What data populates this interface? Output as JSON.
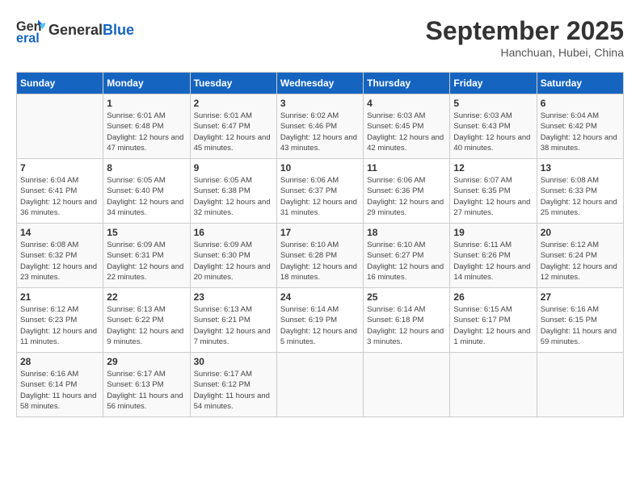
{
  "header": {
    "logo_line1": "General",
    "logo_line2": "Blue",
    "month": "September 2025",
    "location": "Hanchuan, Hubei, China"
  },
  "days_of_week": [
    "Sunday",
    "Monday",
    "Tuesday",
    "Wednesday",
    "Thursday",
    "Friday",
    "Saturday"
  ],
  "weeks": [
    [
      {
        "day": "",
        "info": ""
      },
      {
        "day": "1",
        "info": "Sunrise: 6:01 AM\nSunset: 6:48 PM\nDaylight: 12 hours\nand 47 minutes."
      },
      {
        "day": "2",
        "info": "Sunrise: 6:01 AM\nSunset: 6:47 PM\nDaylight: 12 hours\nand 45 minutes."
      },
      {
        "day": "3",
        "info": "Sunrise: 6:02 AM\nSunset: 6:46 PM\nDaylight: 12 hours\nand 43 minutes."
      },
      {
        "day": "4",
        "info": "Sunrise: 6:03 AM\nSunset: 6:45 PM\nDaylight: 12 hours\nand 42 minutes."
      },
      {
        "day": "5",
        "info": "Sunrise: 6:03 AM\nSunset: 6:43 PM\nDaylight: 12 hours\nand 40 minutes."
      },
      {
        "day": "6",
        "info": "Sunrise: 6:04 AM\nSunset: 6:42 PM\nDaylight: 12 hours\nand 38 minutes."
      }
    ],
    [
      {
        "day": "7",
        "info": "Sunrise: 6:04 AM\nSunset: 6:41 PM\nDaylight: 12 hours\nand 36 minutes."
      },
      {
        "day": "8",
        "info": "Sunrise: 6:05 AM\nSunset: 6:40 PM\nDaylight: 12 hours\nand 34 minutes."
      },
      {
        "day": "9",
        "info": "Sunrise: 6:05 AM\nSunset: 6:38 PM\nDaylight: 12 hours\nand 32 minutes."
      },
      {
        "day": "10",
        "info": "Sunrise: 6:06 AM\nSunset: 6:37 PM\nDaylight: 12 hours\nand 31 minutes."
      },
      {
        "day": "11",
        "info": "Sunrise: 6:06 AM\nSunset: 6:36 PM\nDaylight: 12 hours\nand 29 minutes."
      },
      {
        "day": "12",
        "info": "Sunrise: 6:07 AM\nSunset: 6:35 PM\nDaylight: 12 hours\nand 27 minutes."
      },
      {
        "day": "13",
        "info": "Sunrise: 6:08 AM\nSunset: 6:33 PM\nDaylight: 12 hours\nand 25 minutes."
      }
    ],
    [
      {
        "day": "14",
        "info": "Sunrise: 6:08 AM\nSunset: 6:32 PM\nDaylight: 12 hours\nand 23 minutes."
      },
      {
        "day": "15",
        "info": "Sunrise: 6:09 AM\nSunset: 6:31 PM\nDaylight: 12 hours\nand 22 minutes."
      },
      {
        "day": "16",
        "info": "Sunrise: 6:09 AM\nSunset: 6:30 PM\nDaylight: 12 hours\nand 20 minutes."
      },
      {
        "day": "17",
        "info": "Sunrise: 6:10 AM\nSunset: 6:28 PM\nDaylight: 12 hours\nand 18 minutes."
      },
      {
        "day": "18",
        "info": "Sunrise: 6:10 AM\nSunset: 6:27 PM\nDaylight: 12 hours\nand 16 minutes."
      },
      {
        "day": "19",
        "info": "Sunrise: 6:11 AM\nSunset: 6:26 PM\nDaylight: 12 hours\nand 14 minutes."
      },
      {
        "day": "20",
        "info": "Sunrise: 6:12 AM\nSunset: 6:24 PM\nDaylight: 12 hours\nand 12 minutes."
      }
    ],
    [
      {
        "day": "21",
        "info": "Sunrise: 6:12 AM\nSunset: 6:23 PM\nDaylight: 12 hours\nand 11 minutes."
      },
      {
        "day": "22",
        "info": "Sunrise: 6:13 AM\nSunset: 6:22 PM\nDaylight: 12 hours\nand 9 minutes."
      },
      {
        "day": "23",
        "info": "Sunrise: 6:13 AM\nSunset: 6:21 PM\nDaylight: 12 hours\nand 7 minutes."
      },
      {
        "day": "24",
        "info": "Sunrise: 6:14 AM\nSunset: 6:19 PM\nDaylight: 12 hours\nand 5 minutes."
      },
      {
        "day": "25",
        "info": "Sunrise: 6:14 AM\nSunset: 6:18 PM\nDaylight: 12 hours\nand 3 minutes."
      },
      {
        "day": "26",
        "info": "Sunrise: 6:15 AM\nSunset: 6:17 PM\nDaylight: 12 hours\nand 1 minute."
      },
      {
        "day": "27",
        "info": "Sunrise: 6:16 AM\nSunset: 6:15 PM\nDaylight: 11 hours\nand 59 minutes."
      }
    ],
    [
      {
        "day": "28",
        "info": "Sunrise: 6:16 AM\nSunset: 6:14 PM\nDaylight: 11 hours\nand 58 minutes."
      },
      {
        "day": "29",
        "info": "Sunrise: 6:17 AM\nSunset: 6:13 PM\nDaylight: 11 hours\nand 56 minutes."
      },
      {
        "day": "30",
        "info": "Sunrise: 6:17 AM\nSunset: 6:12 PM\nDaylight: 11 hours\nand 54 minutes."
      },
      {
        "day": "",
        "info": ""
      },
      {
        "day": "",
        "info": ""
      },
      {
        "day": "",
        "info": ""
      },
      {
        "day": "",
        "info": ""
      }
    ]
  ]
}
